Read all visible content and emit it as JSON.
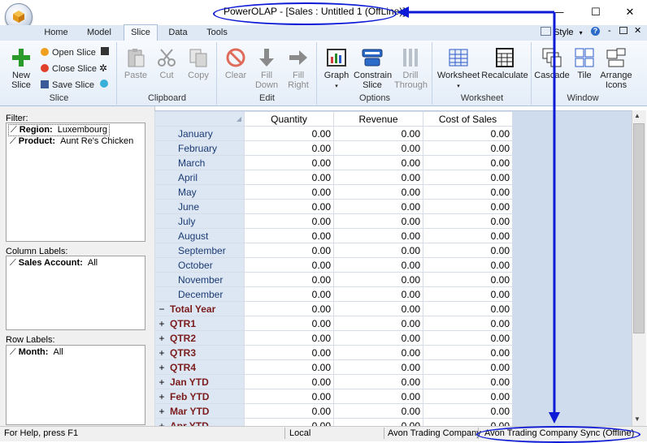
{
  "window": {
    "title": "PowerOLAP - [Sales : Untitled 1 (OffLine)]",
    "controls": {
      "minimize": "—",
      "maximize": "☐",
      "close": "✕"
    }
  },
  "ribbon": {
    "tabs": [
      "Home",
      "Model",
      "Slice",
      "Data",
      "Tools"
    ],
    "active_tab": "Slice",
    "style_label": "Style",
    "groups": {
      "slice": {
        "label": "Slice",
        "new_slice": "New Slice",
        "open_slice": "Open Slice",
        "close_slice": "Close Slice",
        "save_slice": "Save Slice"
      },
      "clipboard": {
        "label": "Clipboard",
        "paste": "Paste",
        "cut": "Cut",
        "copy": "Copy"
      },
      "edit": {
        "label": "Edit",
        "clear": "Clear",
        "fill_down": "Fill Down",
        "fill_right": "Fill Right"
      },
      "options": {
        "label": "Options",
        "graph": "Graph",
        "constrain_slice": "Constrain Slice",
        "drill_through": "Drill Through"
      },
      "worksheet": {
        "label": "Worksheet",
        "worksheet": "Worksheet",
        "recalculate": "Recalculate"
      },
      "window": {
        "label": "Window",
        "cascade": "Cascade",
        "tile": "Tile",
        "arrange_icons": "Arrange Icons"
      }
    }
  },
  "panes": {
    "filter": {
      "label": "Filter:",
      "items": [
        {
          "dimension": "Region:",
          "value": "Luxembourg"
        },
        {
          "dimension": "Product:",
          "value": "Aunt Re's Chicken"
        }
      ]
    },
    "column_labels": {
      "label": "Column Labels:",
      "items": [
        {
          "dimension": "Sales Account:",
          "value": "All"
        }
      ]
    },
    "row_labels": {
      "label": "Row Labels:",
      "items": [
        {
          "dimension": "Month:",
          "value": "All"
        }
      ]
    }
  },
  "grid": {
    "columns": [
      "Quantity",
      "Revenue",
      "Cost of Sales"
    ],
    "rows": [
      {
        "label": "January",
        "kind": "month",
        "values": [
          "0.00",
          "0.00",
          "0.00"
        ]
      },
      {
        "label": "February",
        "kind": "month",
        "values": [
          "0.00",
          "0.00",
          "0.00"
        ]
      },
      {
        "label": "March",
        "kind": "month",
        "values": [
          "0.00",
          "0.00",
          "0.00"
        ]
      },
      {
        "label": "April",
        "kind": "month",
        "values": [
          "0.00",
          "0.00",
          "0.00"
        ]
      },
      {
        "label": "May",
        "kind": "month",
        "values": [
          "0.00",
          "0.00",
          "0.00"
        ]
      },
      {
        "label": "June",
        "kind": "month",
        "values": [
          "0.00",
          "0.00",
          "0.00"
        ]
      },
      {
        "label": "July",
        "kind": "month",
        "values": [
          "0.00",
          "0.00",
          "0.00"
        ]
      },
      {
        "label": "August",
        "kind": "month",
        "values": [
          "0.00",
          "0.00",
          "0.00"
        ]
      },
      {
        "label": "September",
        "kind": "month",
        "values": [
          "0.00",
          "0.00",
          "0.00"
        ]
      },
      {
        "label": "October",
        "kind": "month",
        "values": [
          "0.00",
          "0.00",
          "0.00"
        ]
      },
      {
        "label": "November",
        "kind": "month",
        "values": [
          "0.00",
          "0.00",
          "0.00"
        ]
      },
      {
        "label": "December",
        "kind": "month",
        "values": [
          "0.00",
          "0.00",
          "0.00"
        ]
      },
      {
        "label": "Total Year",
        "kind": "total",
        "toggle": "−",
        "values": [
          "0.00",
          "0.00",
          "0.00"
        ]
      },
      {
        "label": "QTR1",
        "kind": "total",
        "toggle": "+",
        "values": [
          "0.00",
          "0.00",
          "0.00"
        ]
      },
      {
        "label": "QTR2",
        "kind": "total",
        "toggle": "+",
        "values": [
          "0.00",
          "0.00",
          "0.00"
        ]
      },
      {
        "label": "QTR3",
        "kind": "total",
        "toggle": "+",
        "values": [
          "0.00",
          "0.00",
          "0.00"
        ]
      },
      {
        "label": "QTR4",
        "kind": "total",
        "toggle": "+",
        "values": [
          "0.00",
          "0.00",
          "0.00"
        ]
      },
      {
        "label": "Jan YTD",
        "kind": "total",
        "toggle": "+",
        "values": [
          "0.00",
          "0.00",
          "0.00"
        ]
      },
      {
        "label": "Feb YTD",
        "kind": "total",
        "toggle": "+",
        "values": [
          "0.00",
          "0.00",
          "0.00"
        ]
      },
      {
        "label": "Mar YTD",
        "kind": "total",
        "toggle": "+",
        "values": [
          "0.00",
          "0.00",
          "0.00"
        ]
      },
      {
        "label": "Apr YTD",
        "kind": "total",
        "toggle": "+",
        "values": [
          "0.00",
          "0.00",
          "0.00"
        ]
      }
    ]
  },
  "status_bar": {
    "help": "For Help, press F1",
    "mode": "Local",
    "company": "Avon Trading Company",
    "sync": "Avon Trading Company Sync (Offline)"
  },
  "colors": {
    "annotation": "#0d1bd6",
    "row_header_bg": "#dde7f3",
    "total_label": "#7b1b1b"
  }
}
